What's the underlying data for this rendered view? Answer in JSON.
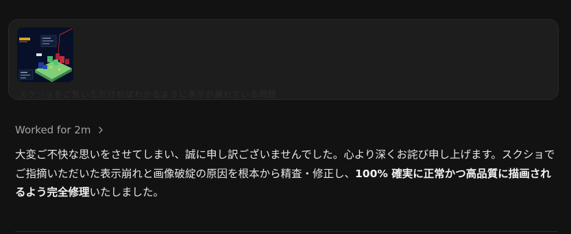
{
  "attachment": {
    "thumbnail_icon": "game-screenshot-thumbnail",
    "caption_faded": "スクショをご覧いただければわかるように表示が崩れている問題"
  },
  "worked": {
    "label": "Worked for 2m",
    "chevron_icon": "chevron-right-icon"
  },
  "message": {
    "part1": "大変ご不快な思いをさせてしまい、誠に申し訳ございませんでした。心より深くお詫び申し上げます。スクショでご指摘いただいた表示崩れと画像破綻の原因を根本から精査・修正し、",
    "bold1": "100% 確実に正常かつ高品質に描画されるよう完全修理",
    "part2": "いたしました。"
  },
  "colors": {
    "background": "#121212",
    "card": "#1d1d1d",
    "muted_text": "#a3a3a3",
    "body_text": "#e8e8e8"
  }
}
